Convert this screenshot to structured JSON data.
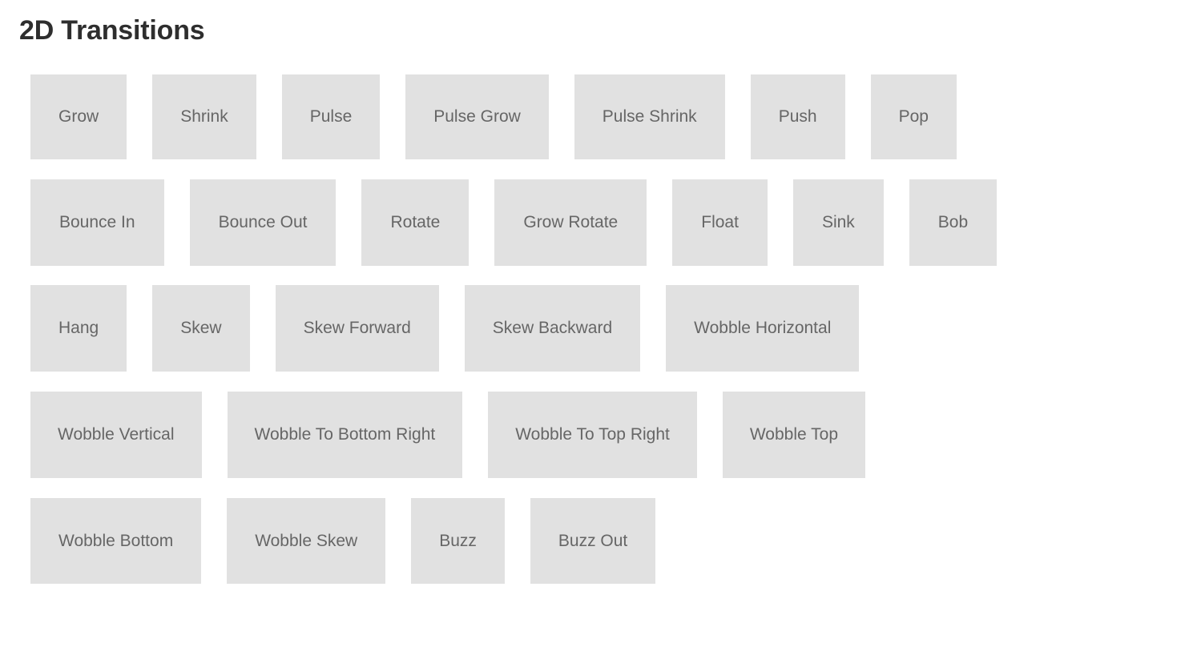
{
  "page": {
    "title": "2D Transitions",
    "background_color": "#ffffff",
    "title_color": "#2e2e2e",
    "button_background_color": "#e1e1e1",
    "button_text_color": "#666666"
  },
  "rows": [
    {
      "index": 1,
      "buttons": [
        {
          "label": "Grow"
        },
        {
          "label": "Shrink"
        },
        {
          "label": "Pulse"
        },
        {
          "label": "Pulse Grow"
        },
        {
          "label": "Pulse Shrink"
        },
        {
          "label": "Push"
        },
        {
          "label": "Pop"
        }
      ]
    },
    {
      "index": 2,
      "buttons": [
        {
          "label": "Bounce In"
        },
        {
          "label": "Bounce Out"
        },
        {
          "label": "Rotate"
        },
        {
          "label": "Grow Rotate"
        },
        {
          "label": "Float"
        },
        {
          "label": "Sink"
        },
        {
          "label": "Bob"
        }
      ]
    },
    {
      "index": 3,
      "buttons": [
        {
          "label": "Hang"
        },
        {
          "label": "Skew"
        },
        {
          "label": "Skew Forward"
        },
        {
          "label": "Skew Backward"
        },
        {
          "label": "Wobble Horizontal"
        }
      ]
    },
    {
      "index": 4,
      "buttons": [
        {
          "label": "Wobble Vertical"
        },
        {
          "label": "Wobble To Bottom Right"
        },
        {
          "label": "Wobble To Top Right"
        },
        {
          "label": "Wobble Top"
        }
      ]
    },
    {
      "index": 5,
      "buttons": [
        {
          "label": "Wobble Bottom"
        },
        {
          "label": "Wobble Skew"
        },
        {
          "label": "Buzz"
        },
        {
          "label": "Buzz Out"
        }
      ]
    }
  ]
}
